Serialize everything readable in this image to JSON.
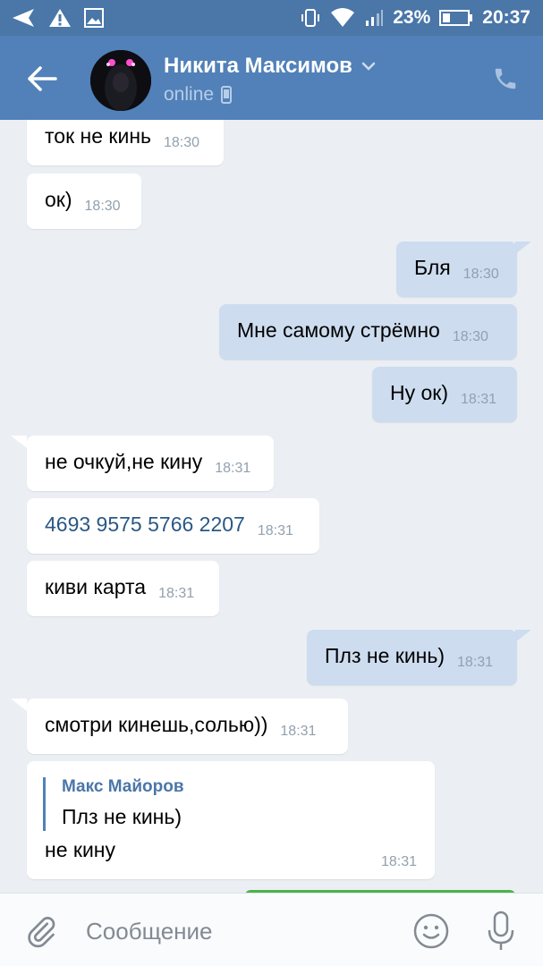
{
  "status_bar": {
    "battery_percent": "23%",
    "time": "20:37",
    "icons": [
      "send-icon",
      "warning-icon",
      "image-icon",
      "vibrate-icon",
      "wifi-icon",
      "signal-icon",
      "battery-icon"
    ]
  },
  "header": {
    "contact_name": "Никита Максимов",
    "status": "online",
    "colors": {
      "bar": "#5181b8",
      "status_bar": "#4a76a8"
    }
  },
  "messages": [
    {
      "dir": "in",
      "text": "ток не кинь",
      "time": "18:30"
    },
    {
      "dir": "in",
      "text": "ок)",
      "time": "18:30"
    },
    {
      "dir": "out",
      "text": "Бля",
      "time": "18:30"
    },
    {
      "dir": "out",
      "text": "Мне самому стрёмно",
      "time": "18:30"
    },
    {
      "dir": "out",
      "text": "Ну ок)",
      "time": "18:31"
    },
    {
      "dir": "in",
      "text": "не очкуй,не кину",
      "time": "18:31"
    },
    {
      "dir": "in",
      "text": "4693 9575 5766 2207",
      "time": "18:31"
    },
    {
      "dir": "in",
      "text": "киви карта",
      "time": "18:31"
    },
    {
      "dir": "out",
      "text": "Плз не кинь)",
      "time": "18:31"
    },
    {
      "dir": "in",
      "text": "смотри кинешь,солью))",
      "time": "18:31"
    }
  ],
  "reply_message": {
    "quoted_author": "Макс Майоров",
    "quoted_text": "Плз не кинь)",
    "text": "не кину",
    "time": "18:31"
  },
  "input_bar": {
    "placeholder": "Сообщение"
  },
  "colors": {
    "background": "#ebeff4",
    "incoming_bubble": "#ffffff",
    "outgoing_bubble": "#cddcef",
    "link": "#2a5885"
  }
}
